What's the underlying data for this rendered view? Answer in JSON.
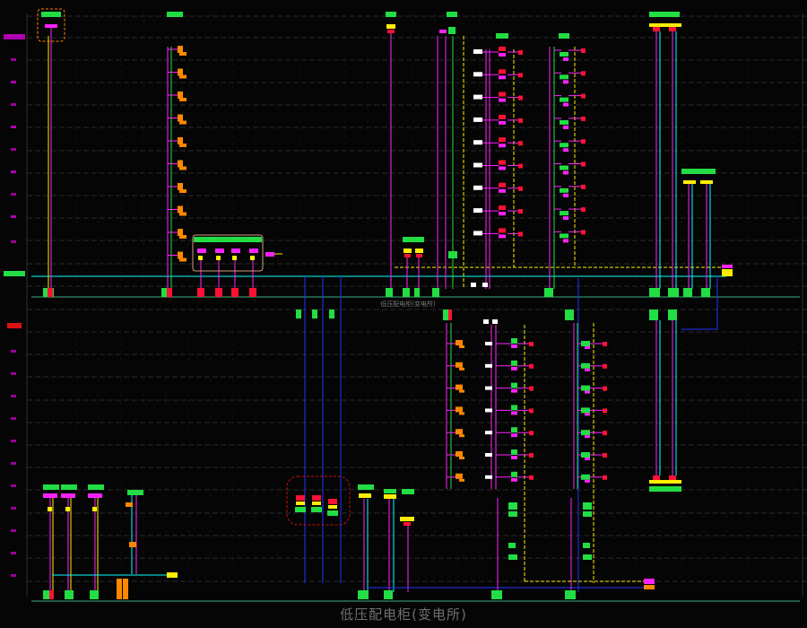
{
  "diagram": {
    "title": "低压配电柜(变电所)",
    "bus_label": "低压配电柜(变电所)",
    "colors": {
      "background": "#050505",
      "grid": "#2a2a2a",
      "bus": "#3fae7f",
      "magenta": "#ff22ff",
      "blue": "#2233ff",
      "yellow": "#ffee00",
      "cyan": "#00ffff",
      "green": "#22dd44",
      "red": "#ff1133",
      "orange": "#ff8800"
    }
  }
}
